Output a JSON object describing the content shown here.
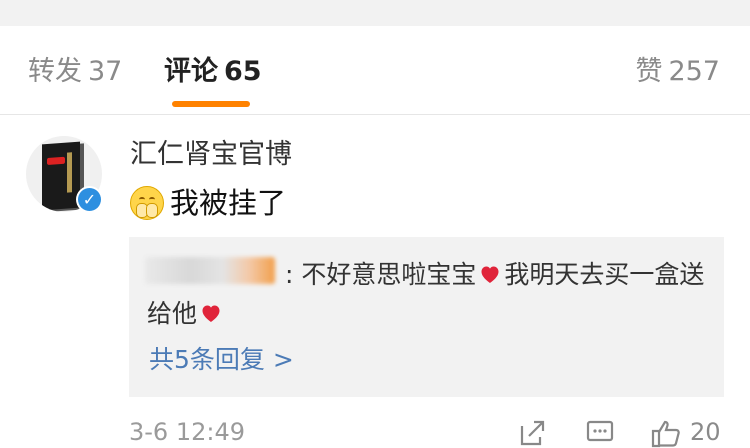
{
  "tabs": {
    "repost": {
      "label": "转发",
      "count": "37"
    },
    "comment": {
      "label": "评论",
      "count": "65"
    },
    "like": {
      "label": "赞",
      "count": "257"
    }
  },
  "accent_color": "#ff8200",
  "link_color": "#4c7bb6",
  "comment": {
    "username": "汇仁肾宝官博",
    "avatar_icon": "product-box-avatar",
    "verified_icon": "verified-badge-icon",
    "emoji_icon": "hands-over-mouth-emoji",
    "text": "我被挂了",
    "reply": {
      "text_part1": ": 不好意思啦宝宝",
      "text_part2": "我明天去买一盒送给他",
      "heart_icon": "red-heart-icon"
    },
    "more_replies": "共5条回复 >",
    "time": "3-6 12:49",
    "like_count": "20"
  }
}
